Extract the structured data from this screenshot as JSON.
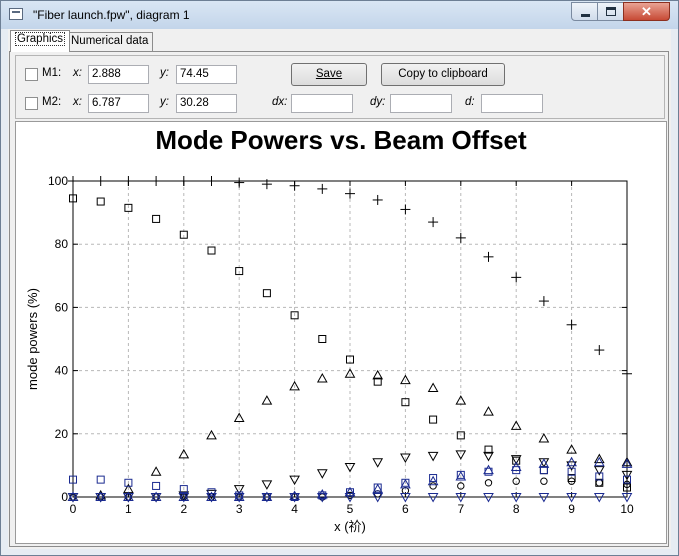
{
  "window": {
    "title": "\"Fiber launch.fpw\", diagram 1",
    "close_glyph": "✕"
  },
  "tabs": [
    {
      "label": "Graphics",
      "active": true
    },
    {
      "label": "Numerical data",
      "active": false
    }
  ],
  "markers": {
    "m1": {
      "label": "M1:",
      "x_label": "x:",
      "x": "2.888",
      "y_label": "y:",
      "y": "74.45",
      "checked": false
    },
    "m2": {
      "label": "M2:",
      "x_label": "x:",
      "x": "6.787",
      "y_label": "y:",
      "y": "30.28",
      "checked": false
    },
    "dx_label": "dx:",
    "dx": "",
    "dy_label": "dy:",
    "dy": "",
    "d_label": "d:",
    "d": ""
  },
  "buttons": {
    "save": "Save",
    "copy": "Copy to clipboard"
  },
  "chart_data": {
    "type": "scatter",
    "title": "Mode Powers vs. Beam Offset",
    "xlabel": "x (祄)",
    "ylabel": "mode powers (%)",
    "xlim": [
      0,
      10
    ],
    "ylim": [
      0,
      100
    ],
    "xticks": [
      0,
      1,
      2,
      3,
      4,
      5,
      6,
      7,
      8,
      9,
      10
    ],
    "yticks": [
      0,
      20,
      40,
      60,
      80,
      100
    ],
    "grid": true,
    "x": [
      0,
      0.5,
      1,
      1.5,
      2,
      2.5,
      3,
      3.5,
      4,
      4.5,
      5,
      5.5,
      6,
      6.5,
      7,
      7.5,
      8,
      8.5,
      9,
      9.5,
      10
    ],
    "series": [
      {
        "marker": "plus",
        "color": "#000000",
        "values": [
          100,
          100,
          100,
          100,
          100,
          100,
          99.5,
          99,
          98.5,
          97.5,
          96,
          94,
          91,
          87,
          82,
          76,
          69.5,
          62,
          54.5,
          46.5,
          39
        ]
      },
      {
        "marker": "square",
        "color": "#000000",
        "values": [
          94.5,
          93.5,
          91.5,
          88,
          83,
          78,
          71.5,
          64.5,
          57.5,
          50,
          43.5,
          36.5,
          30,
          24.5,
          19.5,
          15,
          11.5,
          8.5,
          6,
          4.5,
          3
        ]
      },
      {
        "marker": "triangle-up",
        "color": "#000000",
        "values": [
          0,
          0.5,
          2.5,
          8,
          13.5,
          19.5,
          25,
          30.5,
          35,
          37.5,
          39,
          38.5,
          37,
          34.5,
          30.5,
          27,
          22.5,
          18.5,
          15,
          12,
          11
        ]
      },
      {
        "marker": "triangle-down",
        "color": "#000000",
        "values": [
          0,
          0,
          0,
          0,
          0.5,
          1,
          2.5,
          4,
          5.5,
          7.5,
          9.5,
          11,
          12.5,
          13,
          13.5,
          13,
          12,
          11,
          10,
          8.5,
          7
        ]
      },
      {
        "marker": "circle",
        "color": "#000000",
        "values": [
          0,
          0,
          0,
          0,
          0,
          0,
          0,
          0,
          0,
          0,
          0.5,
          1,
          2,
          3.5,
          3.5,
          4.5,
          5,
          5,
          5,
          4.5,
          4
        ]
      },
      {
        "marker": "square",
        "color": "#1a2a90",
        "values": [
          5.5,
          5.5,
          4.5,
          3.5,
          2.5,
          1.5,
          0.5,
          0,
          0,
          0.5,
          1.5,
          3,
          4.5,
          6,
          7,
          8,
          8.5,
          8.5,
          8,
          6.5,
          5.5
        ]
      },
      {
        "marker": "triangle-up",
        "color": "#1a2a90",
        "values": [
          0,
          0,
          0,
          0,
          0,
          0,
          0,
          0,
          0.3,
          0.8,
          1.5,
          2.5,
          4,
          5,
          6.5,
          8.5,
          9.5,
          10.5,
          11,
          11,
          10.5
        ]
      },
      {
        "marker": "triangle-down",
        "color": "#1a2a90",
        "values": [
          0,
          0,
          0,
          0,
          0,
          0,
          0,
          0,
          0,
          0,
          0,
          0,
          0,
          0,
          0,
          0,
          0,
          0,
          0,
          0,
          0
        ]
      }
    ]
  }
}
